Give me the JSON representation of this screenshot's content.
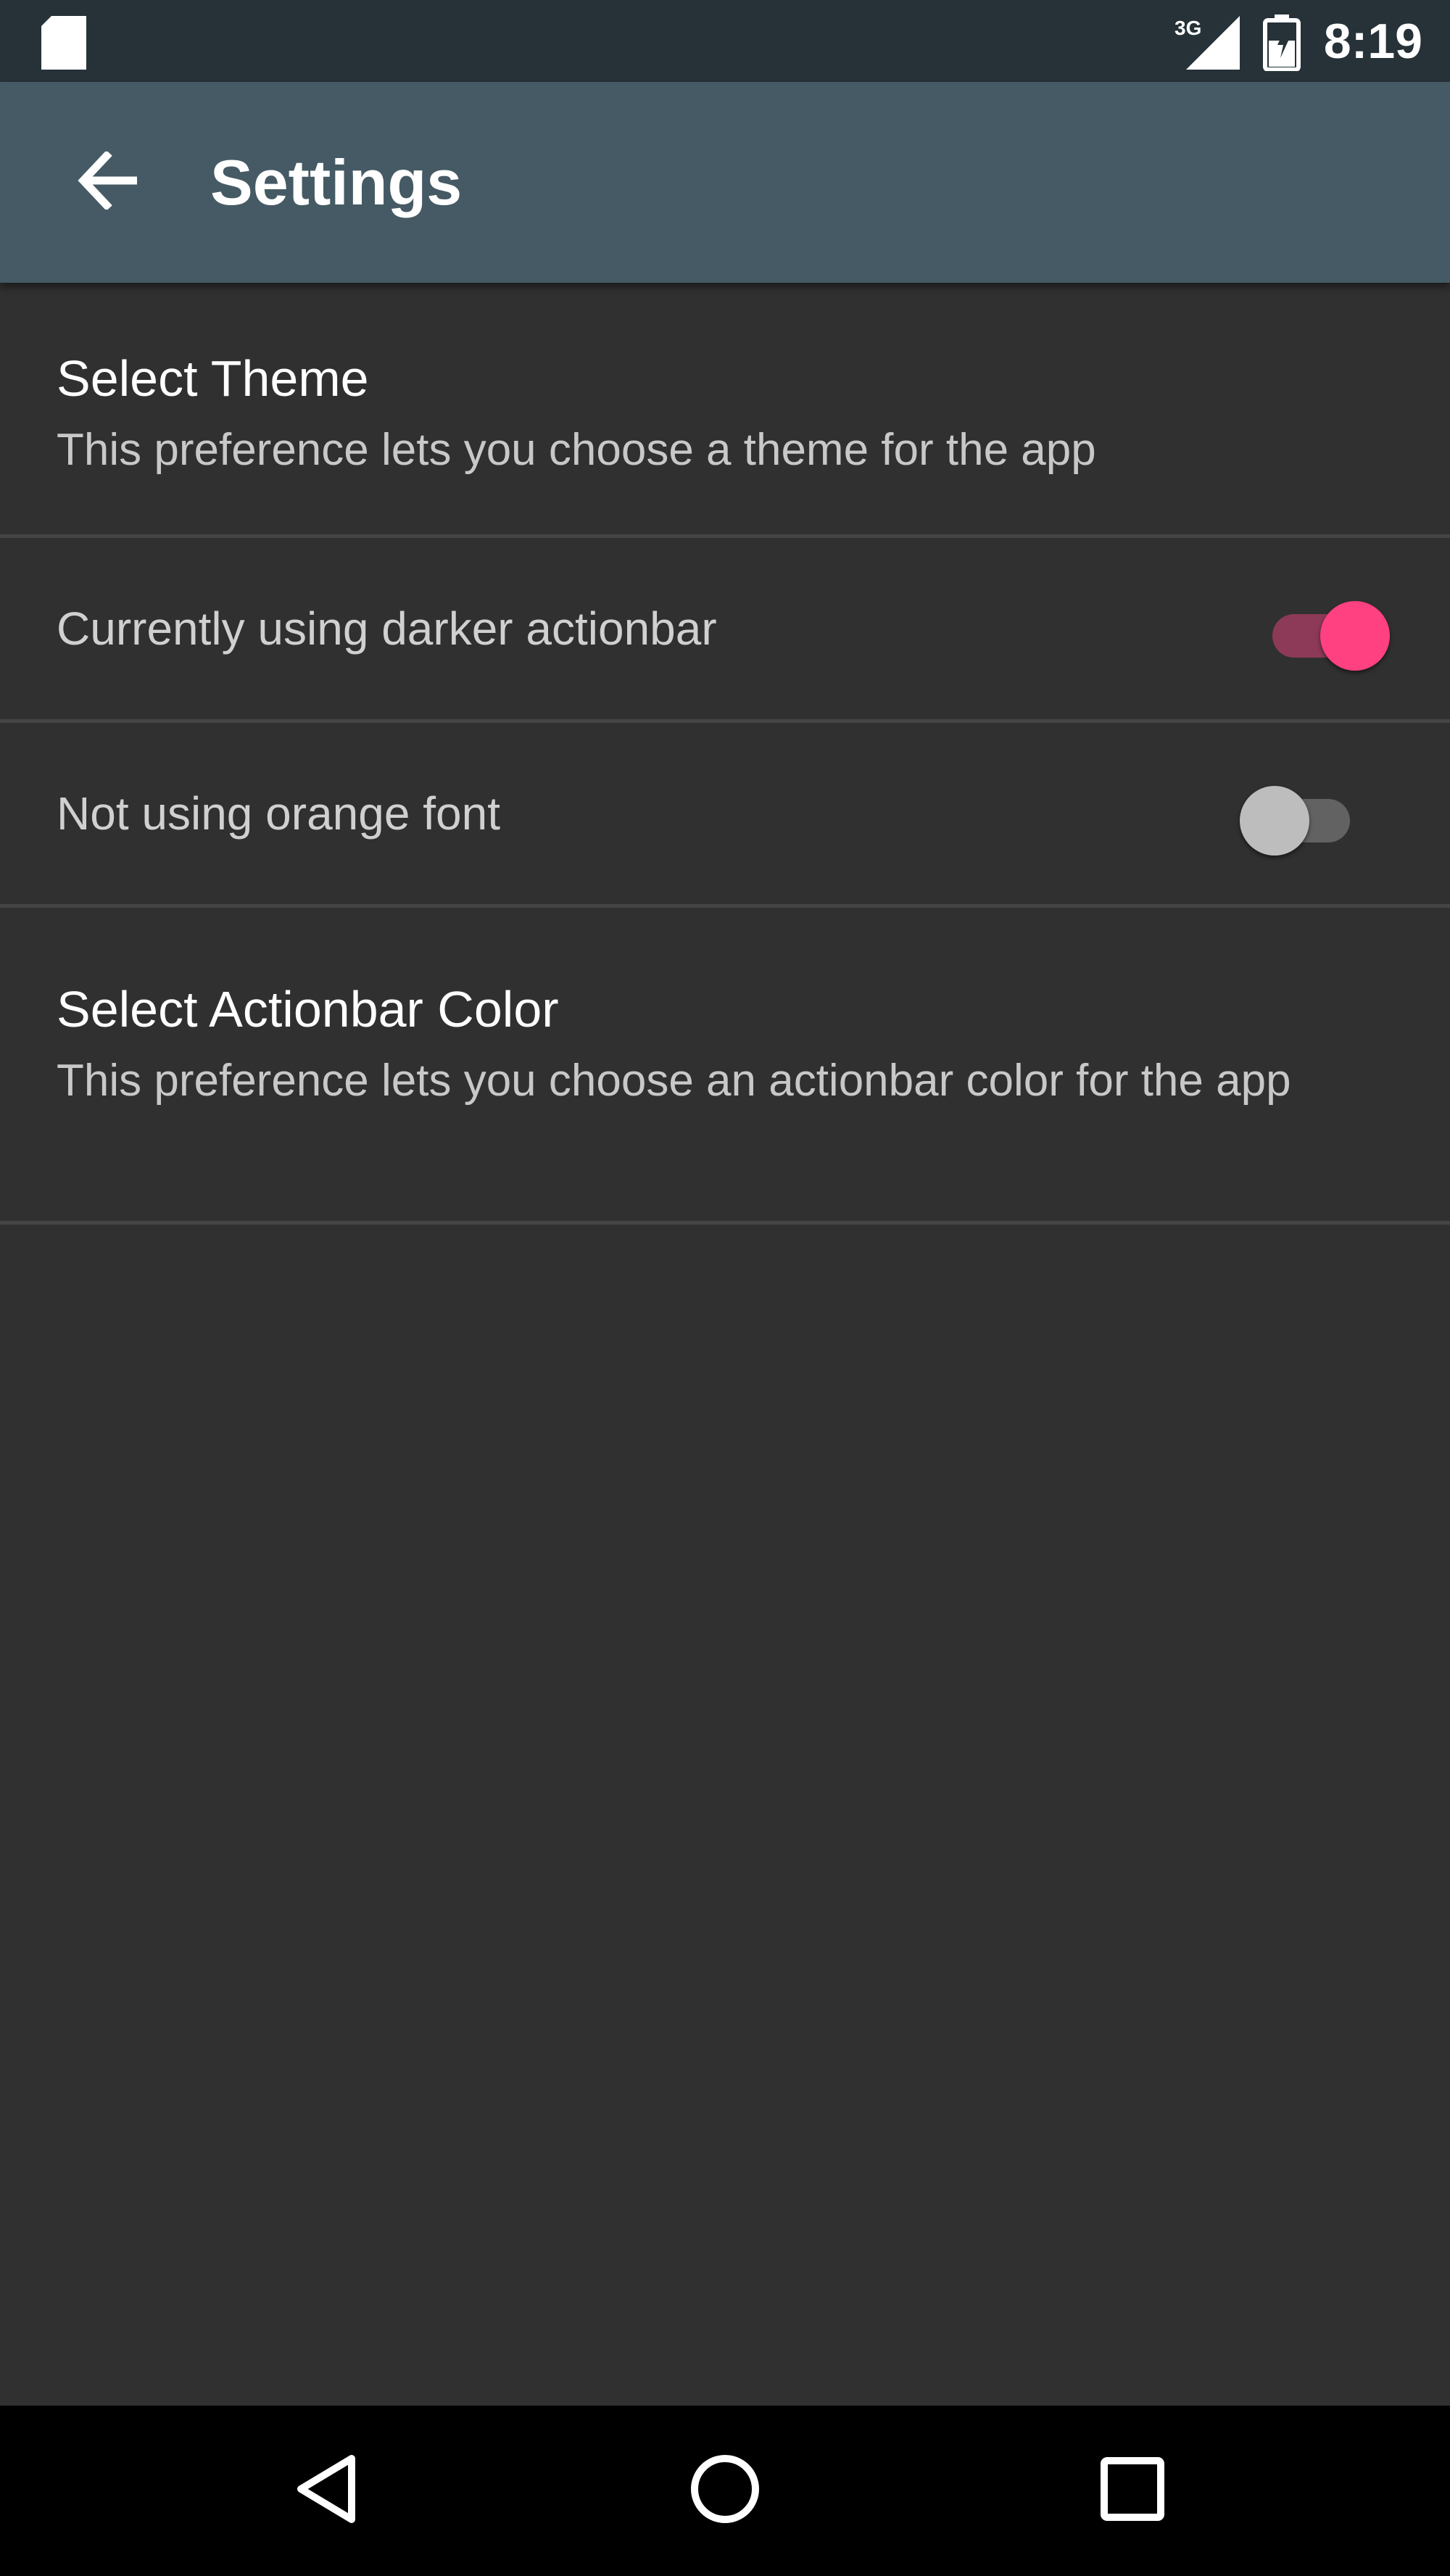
{
  "status_bar": {
    "time": "8:19",
    "network_label": "3G",
    "icons": [
      "sd-card-icon",
      "signal-icon",
      "battery-icon"
    ]
  },
  "app_bar": {
    "title": "Settings",
    "back_icon": "arrow-back-icon",
    "background": "#455a64"
  },
  "preferences": [
    {
      "title": "Select Theme",
      "summary": "This preference lets you choose a theme for the app"
    },
    {
      "label": "Currently using darker actionbar",
      "switch_on": true
    },
    {
      "label": "Not using orange font",
      "switch_on": false
    },
    {
      "title": "Select Actionbar Color",
      "summary": "This preference lets you choose an actionbar color for the app"
    }
  ],
  "nav_bar": {
    "icons": [
      "back-triangle-icon",
      "home-circle-icon",
      "recents-square-icon"
    ]
  },
  "colors": {
    "background": "#303030",
    "status_bar": "#263238",
    "accent": "#ff4081"
  }
}
